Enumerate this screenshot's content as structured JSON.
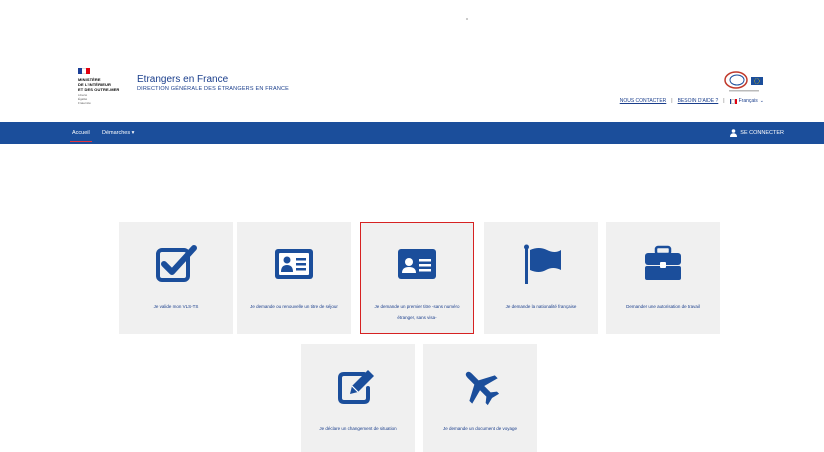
{
  "header": {
    "ministry_lines": [
      "MINISTÈRE",
      "DE L'INTÉRIEUR",
      "ET DES OUTRE-MER"
    ],
    "ministry_motto": [
      "Liberté",
      "Égalité",
      "Fraternité"
    ],
    "site_title": "Etrangers en France",
    "site_subtitle": "DIRECTION GÉNÉRALE DES ÉTRANGERS EN FRANCE",
    "links": {
      "contact": "NOUS CONTACTER",
      "help": "BESOIN D'AIDE ?",
      "language": "Français"
    }
  },
  "navbar": {
    "home": "Accueil",
    "procedures": "Démarches",
    "login": "SE CONNECTER"
  },
  "tiles": [
    {
      "label": "Je valide mon VLS-TS",
      "icon": "checkbox-icon"
    },
    {
      "label": "Je demande ou renouvelle un titre de séjour",
      "icon": "id-card-icon"
    },
    {
      "label": "Je demande un premier titre -sans numéro étranger, sans visa-",
      "icon": "id-card-icon",
      "highlighted": true
    },
    {
      "label": "Je demande la nationalité française",
      "icon": "flag-icon"
    },
    {
      "label": "Demander une autorisation de travail",
      "icon": "briefcase-icon"
    },
    {
      "label": "Je déclare un changement de situation",
      "icon": "edit-icon"
    },
    {
      "label": "Je demande un document de voyage",
      "icon": "plane-icon"
    }
  ],
  "colors": {
    "primary": "#1b4e9b",
    "tile_bg": "#f0f0f0",
    "highlight": "#d62222",
    "nav_active": "#e6373f"
  }
}
